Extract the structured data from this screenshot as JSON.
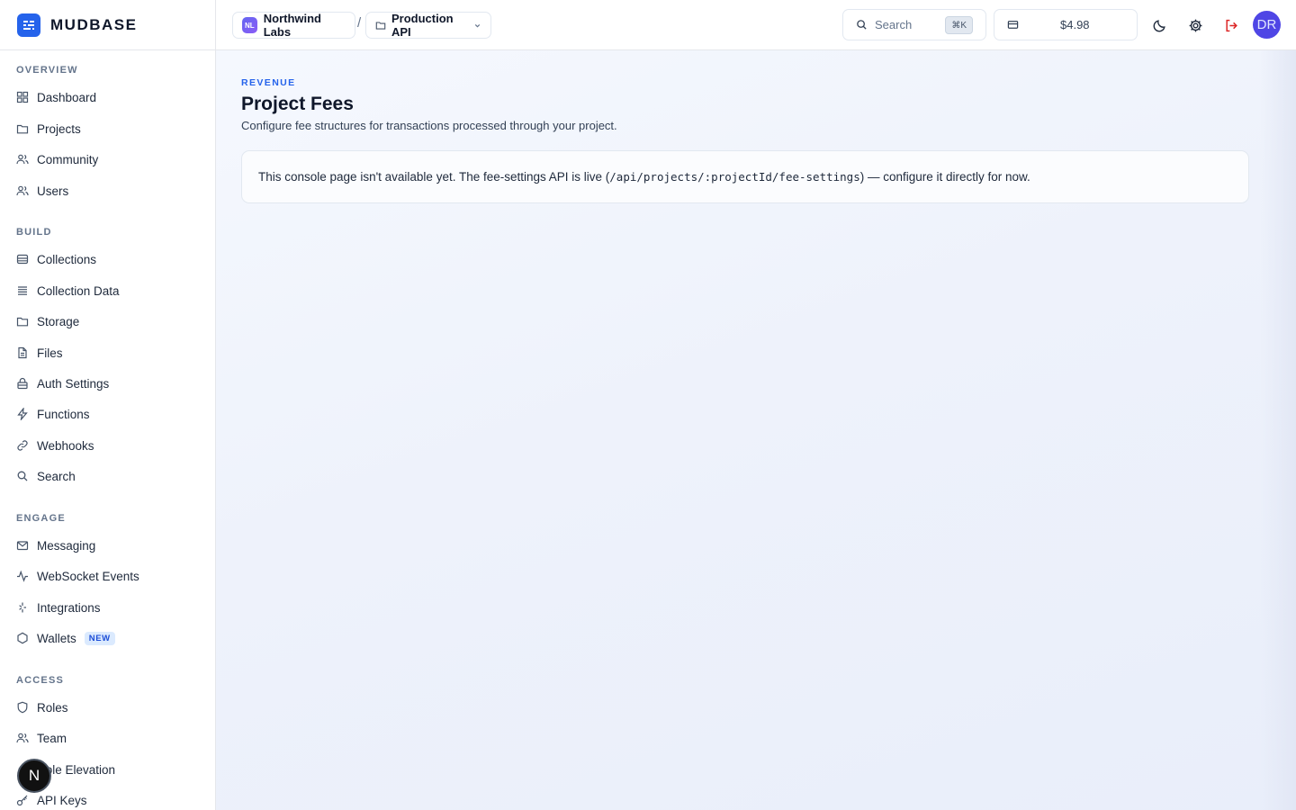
{
  "brand": {
    "name": "MUDBASE"
  },
  "sidebar": {
    "sections": [
      {
        "title": "OVERVIEW",
        "items": [
          {
            "label": "Dashboard",
            "icon": "grid-icon"
          },
          {
            "label": "Projects",
            "icon": "folder-icon"
          },
          {
            "label": "Community",
            "icon": "users-icon"
          },
          {
            "label": "Users",
            "icon": "users-icon"
          }
        ]
      },
      {
        "title": "BUILD",
        "items": [
          {
            "label": "Collections",
            "icon": "database-icon"
          },
          {
            "label": "Collection Data",
            "icon": "list-icon"
          },
          {
            "label": "Storage",
            "icon": "folder-icon"
          },
          {
            "label": "Files",
            "icon": "file-icon"
          },
          {
            "label": "Auth Settings",
            "icon": "lock-icon"
          },
          {
            "label": "Functions",
            "icon": "bolt-icon"
          },
          {
            "label": "Webhooks",
            "icon": "link-icon"
          },
          {
            "label": "Search",
            "icon": "search-icon"
          }
        ]
      },
      {
        "title": "ENGAGE",
        "items": [
          {
            "label": "Messaging",
            "icon": "mail-icon"
          },
          {
            "label": "WebSocket Events",
            "icon": "activity-icon"
          },
          {
            "label": "Integrations",
            "icon": "sparkle-icon"
          },
          {
            "label": "Wallets",
            "icon": "hexagon-icon",
            "badge": "NEW"
          }
        ]
      },
      {
        "title": "ACCESS",
        "items": [
          {
            "label": "Roles",
            "icon": "shield-icon"
          },
          {
            "label": "Team",
            "icon": "users-icon"
          },
          {
            "label": "Role Elevation",
            "icon": "arrow-up-icon"
          },
          {
            "label": "API Keys",
            "icon": "key-icon"
          }
        ]
      }
    ]
  },
  "topbar": {
    "org": {
      "initials": "NL",
      "name": "Northwind Labs"
    },
    "separator": "/",
    "project": {
      "name": "Production API"
    },
    "search": {
      "placeholder": "Search",
      "shortcut": "⌘K"
    },
    "billing": {
      "amount": "$4.98"
    },
    "user": {
      "initials": "DR"
    }
  },
  "main": {
    "eyebrow": "REVENUE",
    "title": "Project Fees",
    "subtitle": "Configure fee structures for transactions processed through your project.",
    "notice": {
      "before": "This console page isn't available yet. The fee-settings API is live (",
      "code": "/api/projects/:projectId/fee-settings",
      "after": ") — configure it directly for now."
    }
  },
  "dev_badge": {
    "label": "N"
  },
  "colors": {
    "accent": "#2563eb",
    "logout": "#dc2626",
    "avatar": "#4f46e5"
  }
}
